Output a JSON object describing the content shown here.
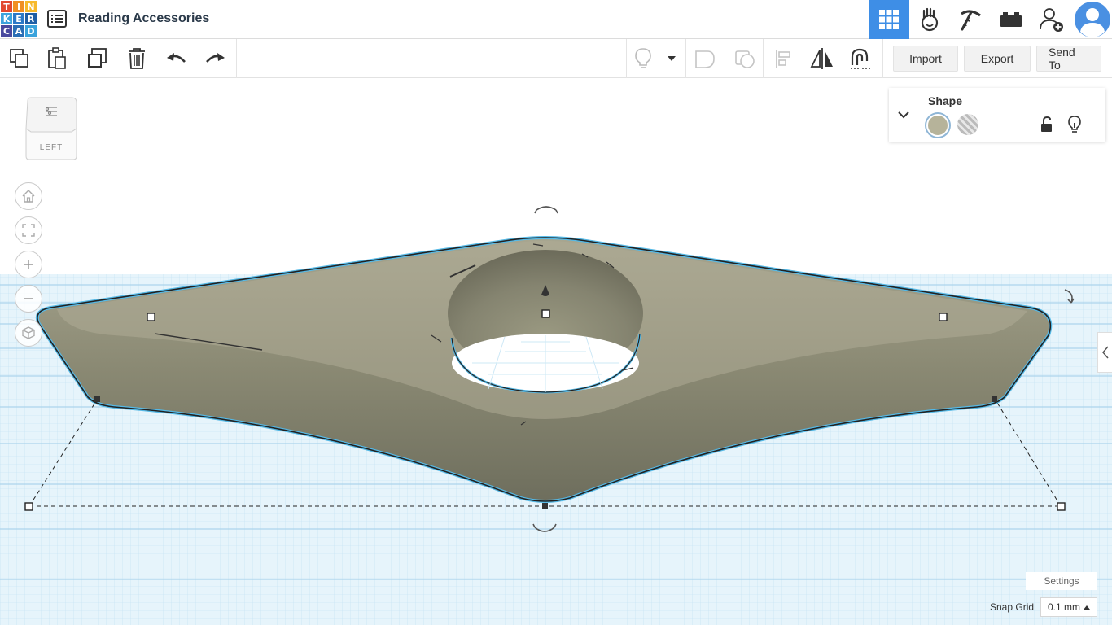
{
  "app": {
    "logo_letters": [
      "T",
      "I",
      "N",
      "K",
      "E",
      "R",
      "C",
      "A",
      "D"
    ],
    "logo_colors": [
      "#e2492f",
      "#f08f24",
      "#f7b92b",
      "#3ca3dc",
      "#2b79c7",
      "#1f5fa6",
      "#4a4a9e",
      "#2a6eb5",
      "#3aa3dc"
    ],
    "title": "Reading Accessories"
  },
  "header": {
    "buttons": [
      {
        "name": "3d-design-view",
        "icon": "grid-icon",
        "active": true
      },
      {
        "name": "blocks-view",
        "icon": "hand-icon"
      },
      {
        "name": "bricks-view",
        "icon": "pickaxe-icon"
      },
      {
        "name": "lego-view",
        "icon": "brick-icon"
      },
      {
        "name": "invite",
        "icon": "add-user-icon"
      },
      {
        "name": "profile",
        "icon": "avatar-icon"
      }
    ],
    "accent_color": "#3e8ee6"
  },
  "toolbar": {
    "tools": [
      "copy",
      "paste",
      "duplicate",
      "delete",
      "undo",
      "redo"
    ],
    "import_label": "Import",
    "export_label": "Export",
    "send_to_label": "Send To"
  },
  "viewcube": {
    "face_label": "LEFT"
  },
  "shape_panel": {
    "title": "Shape",
    "solid_color": "#b6b39a"
  },
  "bottom": {
    "settings_label": "Settings",
    "snap_grid_label": "Snap Grid",
    "snap_grid_value": "0.1 mm"
  }
}
